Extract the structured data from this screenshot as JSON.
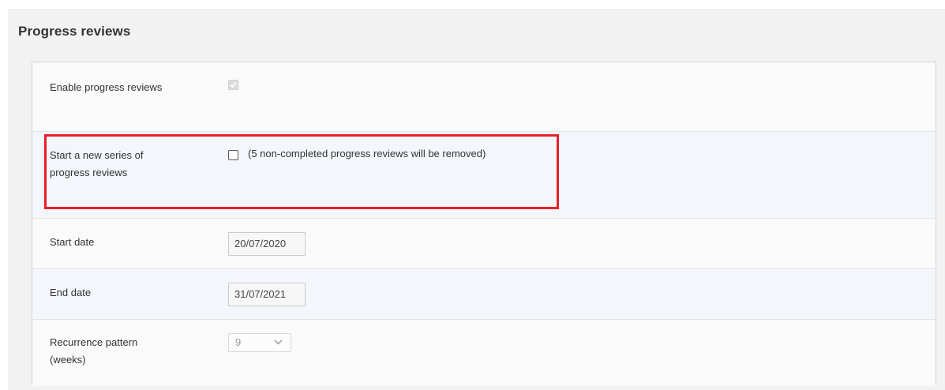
{
  "section": {
    "title": "Progress reviews"
  },
  "rows": {
    "enable": {
      "label": "Enable progress reviews",
      "checked": true,
      "disabled": true
    },
    "new_series": {
      "label": "Start a new series of progress reviews",
      "checked": false,
      "note": "(5 non-completed progress reviews will be removed)"
    },
    "start_date": {
      "label": "Start date",
      "value": "20/07/2020"
    },
    "end_date": {
      "label": "End date",
      "value": "31/07/2021"
    },
    "recurrence": {
      "label": "Recurrence pattern (weeks)",
      "selected": "9"
    }
  },
  "colors": {
    "highlight_border": "#e8202a",
    "panel_bg": "#f2f2f2",
    "alt_row_bg": "#f3f6fa"
  },
  "icons": {
    "checkmark": "check-icon",
    "dropdown": "chevron-down-icon"
  }
}
